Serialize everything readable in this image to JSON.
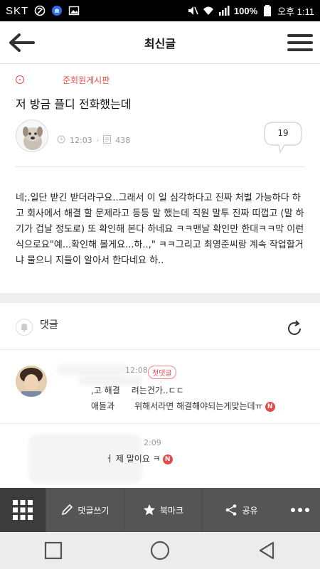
{
  "status_bar": {
    "carrier": "SKT",
    "battery": "100%",
    "time": "오후 1:11"
  },
  "header": {
    "title": "최신글"
  },
  "post": {
    "board": "준회원게시판",
    "title": "저 방금 플디 전화했는데",
    "time": "12:03",
    "views": "438",
    "comment_count": "19",
    "body": "네;.일단 받긴 받더라구요..그래서 이 일 심각하다고 진짜 처벌 가능하다 하고 회사에서 해결 할 문제라고 등등 말 했는데 직원 말투 진짜 띠껍고 (말 하기가 겁날 정도로) 또 확인해 본다 하네요 ㅋㅋ맨날 확인만 한대ㅋㅋ막 이런식으로요\"예...확인해 볼게요...하..,\" ㅋㅋ그리고 최영준씨랑 계속 작업할거냐 물으니 지들이 알아서 한다네요 하.."
  },
  "comments": {
    "label": "댓글",
    "items": [
      {
        "time": "12:08",
        "badge": "첫댓글",
        "line1": ",고 해결",
        "line1b": "려는건가..ㄷㄷ",
        "line2": "애들과",
        "line2b": "위해서라면 해결해야되는게맞는데ㅠ",
        "new": "N"
      },
      {
        "time": "2:09",
        "line1": "ㅓ 제 말이요 ㅋ",
        "new": "N"
      }
    ]
  },
  "toolbar": {
    "write_comment": "댓글쓰기",
    "bookmark": "북마크",
    "share": "공유"
  }
}
